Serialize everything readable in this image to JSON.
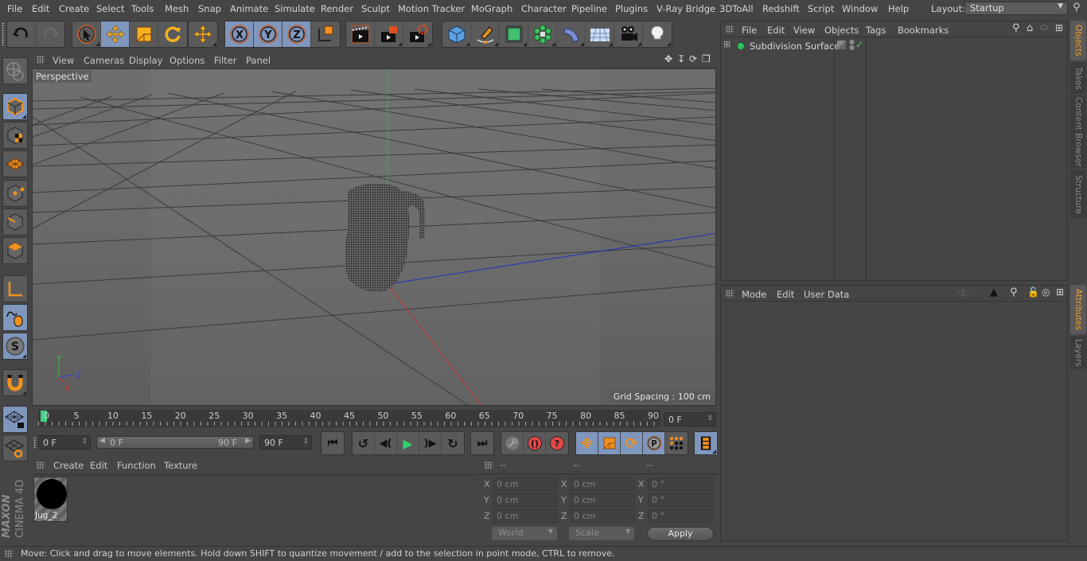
{
  "menubar": {
    "items": [
      "File",
      "Edit",
      "Create",
      "Select",
      "Tools",
      "Mesh",
      "Snap",
      "Animate",
      "Simulate",
      "Render",
      "Sculpt",
      "Motion Tracker",
      "MoGraph",
      "Character",
      "Pipeline",
      "Plugins",
      "V-Ray Bridge",
      "3DToAll",
      "Redshift",
      "Script",
      "Window",
      "Help"
    ],
    "layout_label": "Layout:",
    "layout_value": "Startup"
  },
  "toolbar": {
    "icons": [
      "undo-icon",
      "redo-icon",
      "live-selection-icon",
      "move-icon",
      "scale-icon",
      "rotate-icon",
      "move-last-icon",
      "x-axis-lock-icon",
      "y-axis-lock-icon",
      "z-axis-lock-icon",
      "coordinate-system-icon",
      "render-view-icon",
      "render-to-picture-viewer-icon",
      "render-settings-icon",
      "cube-icon",
      "pen-spline-icon",
      "subdivision-surface-icon",
      "cloner-icon",
      "deformer-icon",
      "floor-icon",
      "camera-icon",
      "light-icon"
    ]
  },
  "viewport": {
    "menu": [
      "View",
      "Cameras",
      "Display",
      "Options",
      "Filter",
      "Panel"
    ],
    "camera_label": "Perspective",
    "grid_spacing": "Grid Spacing : 100 cm",
    "axis_labels": {
      "y": "Y",
      "z": "Z",
      "x": "X"
    }
  },
  "timeline": {
    "ticks": [
      "0",
      "5",
      "10",
      "15",
      "20",
      "25",
      "30",
      "35",
      "40",
      "45",
      "50",
      "55",
      "60",
      "65",
      "70",
      "75",
      "80",
      "85",
      "90"
    ],
    "current_frame": "0 F",
    "start_frame": "0 F",
    "range_start": "0 F",
    "range_end": "90 F",
    "end_frame": "90 F"
  },
  "material_manager": {
    "menu": [
      "Create",
      "Edit",
      "Function",
      "Texture"
    ],
    "materials": [
      {
        "name": "Jug_2"
      }
    ]
  },
  "coordinates": {
    "headers": [
      "--",
      "--",
      "--"
    ],
    "rows": [
      {
        "axis": "X",
        "pos": "0 cm",
        "size": "0 cm",
        "rot": "0 °"
      },
      {
        "axis": "Y",
        "pos": "0 cm",
        "size": "0 cm",
        "rot": "0 °"
      },
      {
        "axis": "Z",
        "pos": "0 cm",
        "size": "0 cm",
        "rot": "0 °"
      }
    ],
    "mode": "World",
    "scale": "Scale",
    "apply": "Apply"
  },
  "object_manager": {
    "menu": [
      "File",
      "Edit",
      "View",
      "Objects",
      "Tags",
      "Bookmarks"
    ],
    "objects": [
      {
        "name": "Subdivision Surface",
        "enabled": true
      }
    ]
  },
  "attribute_manager": {
    "menu": [
      "Mode",
      "Edit",
      "User Data"
    ]
  },
  "side_tabs": {
    "top": [
      "Objects",
      "Takes",
      "Content Browser",
      "Structure"
    ],
    "bottom": [
      "Attributes",
      "Layers"
    ]
  },
  "branding": {
    "maxon": "MAXON",
    "product": "CINEMA 4D"
  },
  "status": "Move: Click and drag to move elements. Hold down SHIFT to quantize movement / add to the selection in point mode, CTRL to remove."
}
